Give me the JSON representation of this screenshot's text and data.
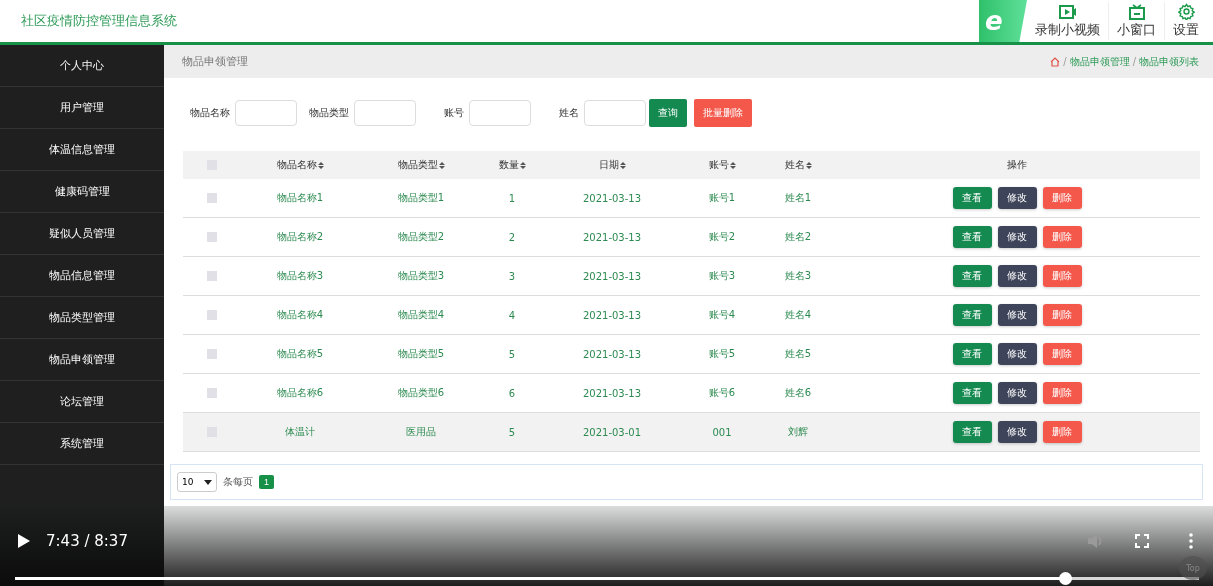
{
  "header": {
    "title": "社区疫情防控管理信息系统",
    "logo_letter": "e",
    "tools": [
      {
        "kind": "video",
        "label": "录制小视频"
      },
      {
        "kind": "tv",
        "label": "小窗口"
      },
      {
        "kind": "gear",
        "label": "设置"
      }
    ]
  },
  "sidebar": {
    "items": [
      {
        "label": "个人中心",
        "selected": false
      },
      {
        "label": "用户管理",
        "selected": false
      },
      {
        "label": "体温信息管理",
        "selected": false
      },
      {
        "label": "健康码管理",
        "selected": false
      },
      {
        "label": "疑似人员管理",
        "selected": false
      },
      {
        "label": "物品信息管理",
        "selected": false
      },
      {
        "label": "物品类型管理",
        "selected": false
      },
      {
        "label": "物品申领管理",
        "selected": false
      },
      {
        "label": "论坛管理",
        "selected": false
      },
      {
        "label": "系统管理",
        "selected": false
      }
    ]
  },
  "page_bar": {
    "title": "物品申领管理",
    "breadcrumb": [
      {
        "kind": "separator",
        "text": "/"
      },
      {
        "kind": "link",
        "text": "物品申领管理"
      },
      {
        "kind": "separator",
        "text": "/"
      },
      {
        "kind": "link",
        "text": "物品申领列表"
      }
    ]
  },
  "filters": {
    "fields": [
      {
        "label": "物品名称"
      },
      {
        "label": "物品类型"
      },
      {
        "label": "账号"
      },
      {
        "label": "姓名"
      }
    ],
    "query_button": "查询",
    "bulk_delete_button": "批量删除"
  },
  "table": {
    "all_checked": false,
    "columns": [
      "物品名称",
      "物品类型",
      "数量",
      "日期",
      "账号",
      "姓名"
    ],
    "actions_column": "操作",
    "rows": [
      {
        "cells": [
          "物品名称1",
          "物品类型1",
          "1",
          "2021-03-13",
          "账号1",
          "姓名1"
        ],
        "checked": false,
        "hovered": false,
        "actions": [
          {
            "kind": "view",
            "label": "查看"
          },
          {
            "kind": "edit",
            "label": "修改"
          },
          {
            "kind": "delete",
            "label": "删除"
          }
        ]
      },
      {
        "cells": [
          "物品名称2",
          "物品类型2",
          "2",
          "2021-03-13",
          "账号2",
          "姓名2"
        ],
        "checked": false,
        "hovered": false,
        "actions": [
          {
            "kind": "view",
            "label": "查看"
          },
          {
            "kind": "edit",
            "label": "修改"
          },
          {
            "kind": "delete",
            "label": "删除"
          }
        ]
      },
      {
        "cells": [
          "物品名称3",
          "物品类型3",
          "3",
          "2021-03-13",
          "账号3",
          "姓名3"
        ],
        "checked": false,
        "hovered": false,
        "actions": [
          {
            "kind": "view",
            "label": "查看"
          },
          {
            "kind": "edit",
            "label": "修改"
          },
          {
            "kind": "delete",
            "label": "删除"
          }
        ]
      },
      {
        "cells": [
          "物品名称4",
          "物品类型4",
          "4",
          "2021-03-13",
          "账号4",
          "姓名4"
        ],
        "checked": false,
        "hovered": false,
        "actions": [
          {
            "kind": "view",
            "label": "查看"
          },
          {
            "kind": "edit",
            "label": "修改"
          },
          {
            "kind": "delete",
            "label": "删除"
          }
        ]
      },
      {
        "cells": [
          "物品名称5",
          "物品类型5",
          "5",
          "2021-03-13",
          "账号5",
          "姓名5"
        ],
        "checked": false,
        "hovered": false,
        "actions": [
          {
            "kind": "view",
            "label": "查看"
          },
          {
            "kind": "edit",
            "label": "修改"
          },
          {
            "kind": "delete",
            "label": "删除"
          }
        ]
      },
      {
        "cells": [
          "物品名称6",
          "物品类型6",
          "6",
          "2021-03-13",
          "账号6",
          "姓名6"
        ],
        "checked": false,
        "hovered": false,
        "actions": [
          {
            "kind": "view",
            "label": "查看"
          },
          {
            "kind": "edit",
            "label": "修改"
          },
          {
            "kind": "delete",
            "label": "删除"
          }
        ]
      },
      {
        "cells": [
          "体温计",
          "医用品",
          "5",
          "2021-03-01",
          "001",
          "刘辉"
        ],
        "checked": false,
        "hovered": true,
        "actions": [
          {
            "kind": "view",
            "label": "查看"
          },
          {
            "kind": "edit",
            "label": "修改"
          },
          {
            "kind": "delete",
            "label": "删除"
          }
        ]
      }
    ]
  },
  "pagination": {
    "page_size": "10",
    "per_page_label": "条每页",
    "pages": [
      {
        "label": "1",
        "selected": true
      }
    ]
  },
  "player": {
    "time": "7:43 / 8:37",
    "level": 0.893,
    "top_label": "Top"
  }
}
